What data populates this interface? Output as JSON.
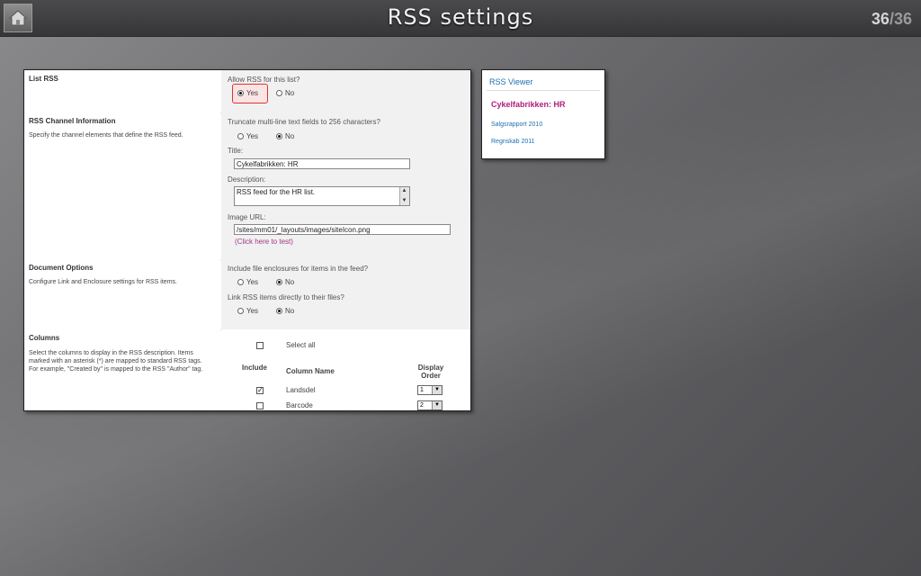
{
  "header": {
    "title": "RSS settings",
    "slide_current": "36",
    "slide_separator": "/",
    "slide_total": "36"
  },
  "panel": {
    "list_rss": {
      "title": "List RSS",
      "question": "Allow RSS for this list?",
      "yes": "Yes",
      "no": "No",
      "selected": "Yes"
    },
    "channel": {
      "title": "RSS Channel Information",
      "desc": "Specify the channel elements that define the RSS feed.",
      "truncate_q": "Truncate multi-line text fields to 256 characters?",
      "yes": "Yes",
      "no": "No",
      "truncate_selected": "No",
      "title_label": "Title:",
      "title_value": "Cykelfabrikken: HR",
      "desc_label": "Description:",
      "desc_value": "RSS feed for the HR list.",
      "image_label": "Image URL:",
      "image_value": "/sites/mm01/_layouts/images/siteIcon.png",
      "test_link": "(Click here to test)"
    },
    "doc_options": {
      "title": "Document Options",
      "desc": "Configure Link and Enclosure settings for RSS items.",
      "enclosures_q": "Include file enclosures for items in the feed?",
      "link_q": "Link RSS items directly to their files?",
      "yes": "Yes",
      "no": "No",
      "enclosures_selected": "No",
      "link_selected": "No"
    },
    "columns": {
      "title": "Columns",
      "desc": "Select the columns to display in the RSS description. Items marked with an asterisk (*) are mapped to standard RSS tags. For example, \"Created by\" is mapped to the RSS \"Author\" tag.",
      "select_all": "Select all",
      "hdr_include": "Include",
      "hdr_name": "Column Name",
      "hdr_order": "Display Order",
      "rows": [
        {
          "name": "Landsdel",
          "checked": true,
          "order": "1"
        },
        {
          "name": "Barcode",
          "checked": false,
          "order": "2"
        }
      ]
    }
  },
  "viewer": {
    "heading": "RSS Viewer",
    "feed_title": "Cykelfabrikken: HR",
    "items": [
      "Salgsrapport 2010",
      "Regnskab 2011"
    ]
  },
  "icons": {
    "home": "home-icon",
    "radio": "radio-button",
    "checkbox": "checkbox",
    "dropdown": "chevron-down-icon"
  }
}
